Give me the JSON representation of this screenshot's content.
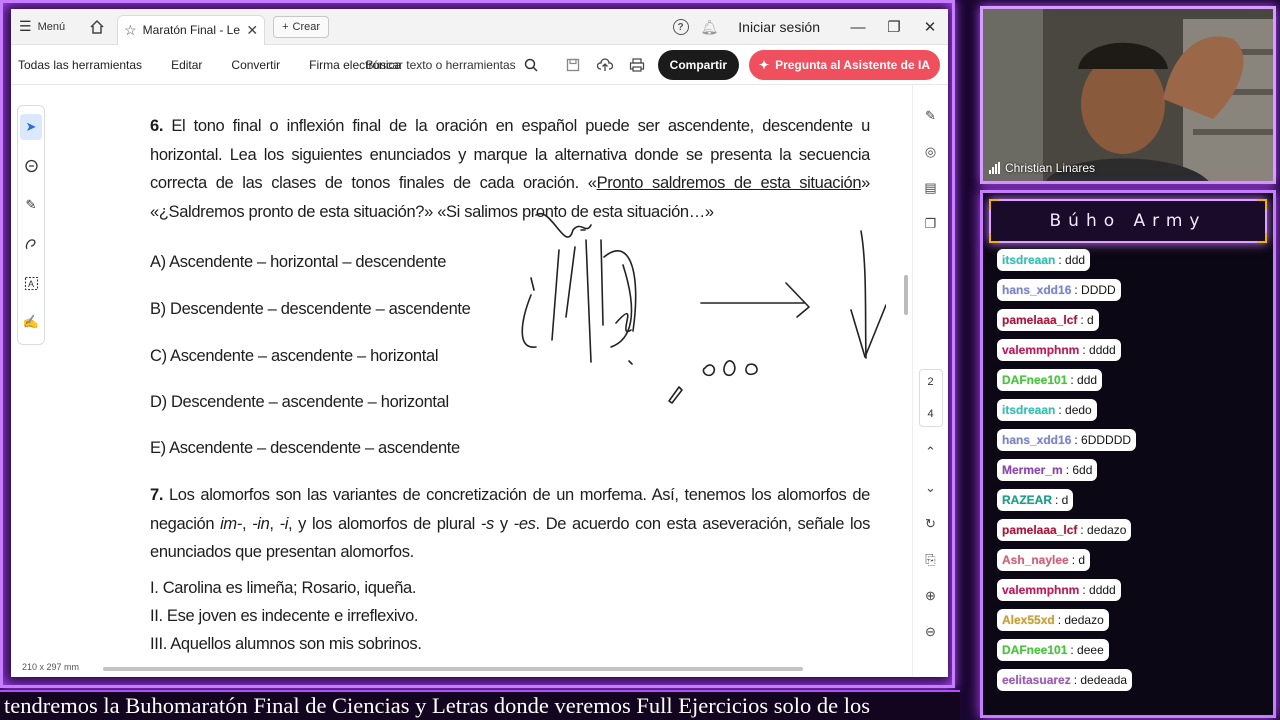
{
  "browser": {
    "menu_label": "Menú",
    "tab_title": "Maratón Final - Leng...",
    "create_label": "Crear",
    "signin_label": "Iniciar sesión"
  },
  "toolbar": {
    "menus": [
      "Todas las herramientas",
      "Editar",
      "Convertir",
      "Firma electrónica"
    ],
    "search_label": "Buscar texto o herramientas",
    "share_label": "Compartir",
    "ai_label": "Pregunta al Asistente de IA"
  },
  "document": {
    "q6": {
      "number": "6.",
      "text_before": "El tono final o inflexión final de la oración en español puede ser ascendente, descendente u horizontal. Lea los siguientes enunciados y marque la alternativa donde se presenta la secuencia correcta de las clases de tonos finales de cada oración. «",
      "underlined": "Pronto saldremos de esta situación",
      "text_after": "» «¿Saldremos pronto de esta situación?» «Si salimos pronto de esta situación…»"
    },
    "options": [
      "A) Ascendente – horizontal – descendente",
      "B) Descendente – descendente – ascendente",
      "C) Ascendente – ascendente – horizontal",
      "D) Descendente – ascendente – horizontal",
      "E) Ascendente – descendente – ascendente"
    ],
    "q7": {
      "number": "7.",
      "text_a": "Los alomorfos son las variantes de concretización de un morfema. Así, tenemos los alomorfos de negación ",
      "ital_1": "im-",
      "sep_1": ", ",
      "ital_2": "-in",
      "sep_2": ", ",
      "ital_3": "-i",
      "text_b": ", y los alomorfos de plural ",
      "ital_4": "-s",
      "text_c": " y ",
      "ital_5": "-es",
      "text_d": ". De acuerdo con esta aseveración, señale los enunciados que presentan alomorfos."
    },
    "statements": [
      "I. Carolina es limeña; Rosario, iqueña.",
      "II. Ese joven es indecente e irreflexivo.",
      "III. Aquellos alumnos son mis sobrinos."
    ],
    "page_size": "210 x 297 mm",
    "pages": [
      "2",
      "4"
    ]
  },
  "webcam": {
    "name": "Christian Linares"
  },
  "chat": {
    "title": "Búho Army",
    "messages": [
      {
        "user": "itsdreaan",
        "text": ": ddd",
        "color": "#2ec4b6"
      },
      {
        "user": "hans_xdd16",
        "text": ": DDDD",
        "color": "#7a86c8"
      },
      {
        "user": "pamelaaa_lcf",
        "text": ": d",
        "color": "#b0103a"
      },
      {
        "user": "valemmphnm",
        "text": ": dddd",
        "color": "#c2185b"
      },
      {
        "user": "DAFnee101",
        "text": ": ddd",
        "color": "#43c936"
      },
      {
        "user": "itsdreaan",
        "text": ": dedo",
        "color": "#2ec4b6"
      },
      {
        "user": "hans_xdd16",
        "text": ": 6DDDDD",
        "color": "#7a86c8"
      },
      {
        "user": "Mermer_m",
        "text": ": 6dd",
        "color": "#8e44ad"
      },
      {
        "user": "RAZEAR",
        "text": ": d",
        "color": "#16a085"
      },
      {
        "user": "pamelaaa_lcf",
        "text": ": dedazo",
        "color": "#b0103a"
      },
      {
        "user": "Ash_naylee",
        "text": ": d",
        "color": "#d35f7a"
      },
      {
        "user": "valemmphnm",
        "text": ": dddd",
        "color": "#c2185b"
      },
      {
        "user": "Alex55xd",
        "text": ": dedazo",
        "color": "#c9a227"
      },
      {
        "user": "DAFnee101",
        "text": ": deee",
        "color": "#43c936"
      },
      {
        "user": "eelitasuarez",
        "text": ": dedeada",
        "color": "#9b59b6"
      }
    ]
  },
  "caption": "tendremos la Buhomaratón Final de Ciencias y Letras donde veremos Full Ejercicios solo de los",
  "colors": {
    "accent_purple": "#c77dff",
    "share_dark": "#1b1b1b",
    "ai_red": "#f0505e"
  }
}
